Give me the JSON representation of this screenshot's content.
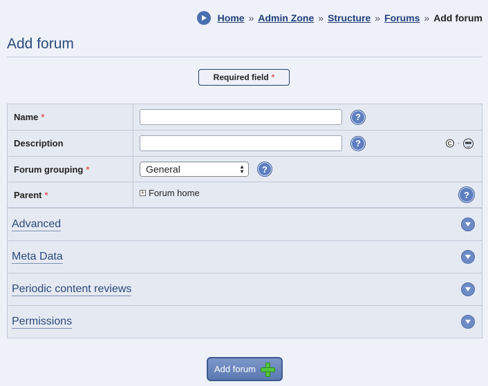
{
  "breadcrumb": {
    "items": [
      "Home",
      "Admin Zone",
      "Structure",
      "Forums"
    ],
    "separator": "»",
    "current": "Add forum"
  },
  "page_title": "Add forum",
  "required_field": {
    "label": "Required field",
    "star": "*"
  },
  "form": {
    "name_label": "Name",
    "description_label": "Description",
    "forum_grouping_label": "Forum grouping",
    "forum_grouping_value": "General",
    "parent_label": "Parent",
    "parent_tree_item": "Forum home",
    "star": "*",
    "help_glyph": "?",
    "comcode_glyph": "C",
    "dot_glyph": "·"
  },
  "sections": [
    "Advanced",
    "Meta Data",
    "Periodic content reviews",
    "Permissions"
  ],
  "submit_button": {
    "label": "Add forum"
  },
  "colors": {
    "accent": "#5d7fc0",
    "required": "#e06060",
    "title": "#2a4a7a"
  }
}
